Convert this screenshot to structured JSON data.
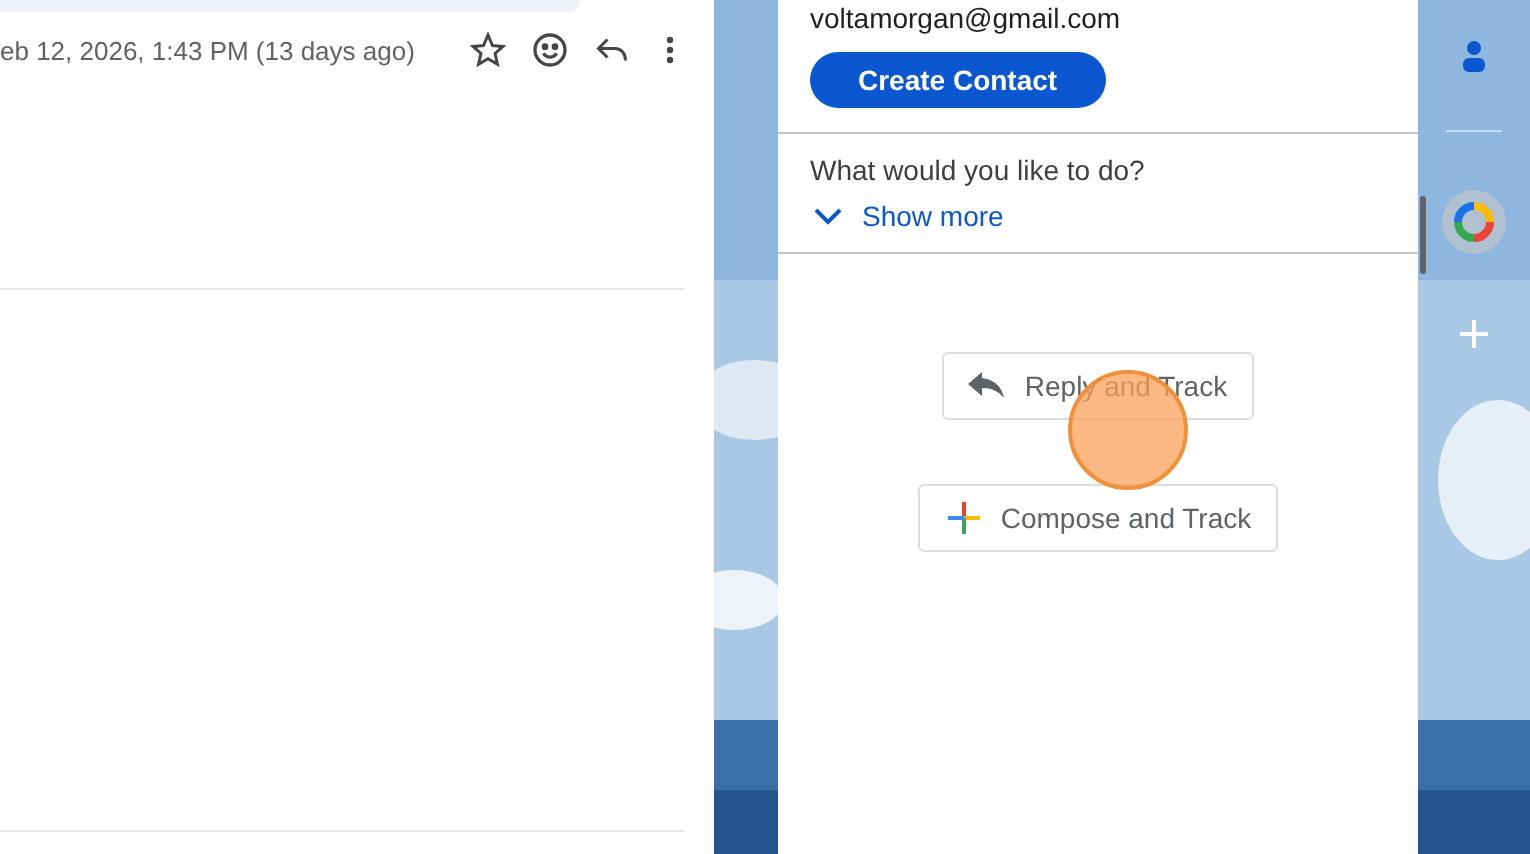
{
  "message_header": {
    "date": "eb 12, 2026, 1:43 PM (13 days ago)"
  },
  "side_panel": {
    "email": "voltamorgan@gmail.com",
    "create_button": "Create Contact",
    "question": "What would you like to do?",
    "show_more": "Show more",
    "actions": [
      {
        "kind": "reply",
        "label": "Reply and Track"
      },
      {
        "kind": "compose",
        "label": "Compose and Track"
      }
    ]
  }
}
